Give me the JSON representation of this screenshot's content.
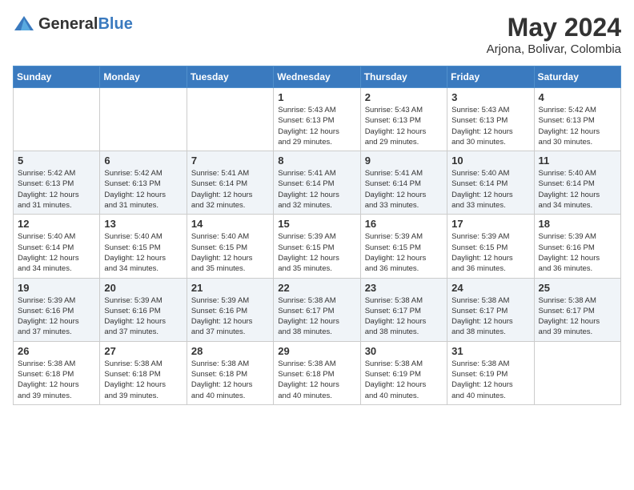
{
  "header": {
    "logo_general": "General",
    "logo_blue": "Blue",
    "title": "May 2024",
    "location": "Arjona, Bolivar, Colombia"
  },
  "calendar": {
    "weekdays": [
      "Sunday",
      "Monday",
      "Tuesday",
      "Wednesday",
      "Thursday",
      "Friday",
      "Saturday"
    ],
    "weeks": [
      [
        {
          "day": "",
          "info": ""
        },
        {
          "day": "",
          "info": ""
        },
        {
          "day": "",
          "info": ""
        },
        {
          "day": "1",
          "info": "Sunrise: 5:43 AM\nSunset: 6:13 PM\nDaylight: 12 hours\nand 29 minutes."
        },
        {
          "day": "2",
          "info": "Sunrise: 5:43 AM\nSunset: 6:13 PM\nDaylight: 12 hours\nand 29 minutes."
        },
        {
          "day": "3",
          "info": "Sunrise: 5:43 AM\nSunset: 6:13 PM\nDaylight: 12 hours\nand 30 minutes."
        },
        {
          "day": "4",
          "info": "Sunrise: 5:42 AM\nSunset: 6:13 PM\nDaylight: 12 hours\nand 30 minutes."
        }
      ],
      [
        {
          "day": "5",
          "info": "Sunrise: 5:42 AM\nSunset: 6:13 PM\nDaylight: 12 hours\nand 31 minutes."
        },
        {
          "day": "6",
          "info": "Sunrise: 5:42 AM\nSunset: 6:13 PM\nDaylight: 12 hours\nand 31 minutes."
        },
        {
          "day": "7",
          "info": "Sunrise: 5:41 AM\nSunset: 6:14 PM\nDaylight: 12 hours\nand 32 minutes."
        },
        {
          "day": "8",
          "info": "Sunrise: 5:41 AM\nSunset: 6:14 PM\nDaylight: 12 hours\nand 32 minutes."
        },
        {
          "day": "9",
          "info": "Sunrise: 5:41 AM\nSunset: 6:14 PM\nDaylight: 12 hours\nand 33 minutes."
        },
        {
          "day": "10",
          "info": "Sunrise: 5:40 AM\nSunset: 6:14 PM\nDaylight: 12 hours\nand 33 minutes."
        },
        {
          "day": "11",
          "info": "Sunrise: 5:40 AM\nSunset: 6:14 PM\nDaylight: 12 hours\nand 34 minutes."
        }
      ],
      [
        {
          "day": "12",
          "info": "Sunrise: 5:40 AM\nSunset: 6:14 PM\nDaylight: 12 hours\nand 34 minutes."
        },
        {
          "day": "13",
          "info": "Sunrise: 5:40 AM\nSunset: 6:15 PM\nDaylight: 12 hours\nand 34 minutes."
        },
        {
          "day": "14",
          "info": "Sunrise: 5:40 AM\nSunset: 6:15 PM\nDaylight: 12 hours\nand 35 minutes."
        },
        {
          "day": "15",
          "info": "Sunrise: 5:39 AM\nSunset: 6:15 PM\nDaylight: 12 hours\nand 35 minutes."
        },
        {
          "day": "16",
          "info": "Sunrise: 5:39 AM\nSunset: 6:15 PM\nDaylight: 12 hours\nand 36 minutes."
        },
        {
          "day": "17",
          "info": "Sunrise: 5:39 AM\nSunset: 6:15 PM\nDaylight: 12 hours\nand 36 minutes."
        },
        {
          "day": "18",
          "info": "Sunrise: 5:39 AM\nSunset: 6:16 PM\nDaylight: 12 hours\nand 36 minutes."
        }
      ],
      [
        {
          "day": "19",
          "info": "Sunrise: 5:39 AM\nSunset: 6:16 PM\nDaylight: 12 hours\nand 37 minutes."
        },
        {
          "day": "20",
          "info": "Sunrise: 5:39 AM\nSunset: 6:16 PM\nDaylight: 12 hours\nand 37 minutes."
        },
        {
          "day": "21",
          "info": "Sunrise: 5:39 AM\nSunset: 6:16 PM\nDaylight: 12 hours\nand 37 minutes."
        },
        {
          "day": "22",
          "info": "Sunrise: 5:38 AM\nSunset: 6:17 PM\nDaylight: 12 hours\nand 38 minutes."
        },
        {
          "day": "23",
          "info": "Sunrise: 5:38 AM\nSunset: 6:17 PM\nDaylight: 12 hours\nand 38 minutes."
        },
        {
          "day": "24",
          "info": "Sunrise: 5:38 AM\nSunset: 6:17 PM\nDaylight: 12 hours\nand 38 minutes."
        },
        {
          "day": "25",
          "info": "Sunrise: 5:38 AM\nSunset: 6:17 PM\nDaylight: 12 hours\nand 39 minutes."
        }
      ],
      [
        {
          "day": "26",
          "info": "Sunrise: 5:38 AM\nSunset: 6:18 PM\nDaylight: 12 hours\nand 39 minutes."
        },
        {
          "day": "27",
          "info": "Sunrise: 5:38 AM\nSunset: 6:18 PM\nDaylight: 12 hours\nand 39 minutes."
        },
        {
          "day": "28",
          "info": "Sunrise: 5:38 AM\nSunset: 6:18 PM\nDaylight: 12 hours\nand 40 minutes."
        },
        {
          "day": "29",
          "info": "Sunrise: 5:38 AM\nSunset: 6:18 PM\nDaylight: 12 hours\nand 40 minutes."
        },
        {
          "day": "30",
          "info": "Sunrise: 5:38 AM\nSunset: 6:19 PM\nDaylight: 12 hours\nand 40 minutes."
        },
        {
          "day": "31",
          "info": "Sunrise: 5:38 AM\nSunset: 6:19 PM\nDaylight: 12 hours\nand 40 minutes."
        },
        {
          "day": "",
          "info": ""
        }
      ]
    ]
  }
}
